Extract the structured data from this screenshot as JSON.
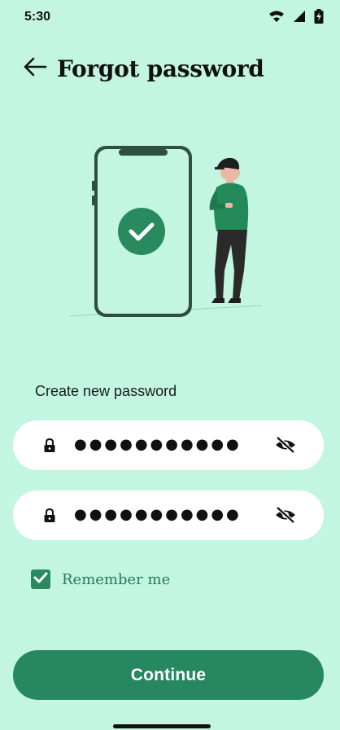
{
  "status_bar": {
    "time": "5:30",
    "icons": [
      "wifi-icon",
      "signal-icon",
      "battery-charging-icon"
    ]
  },
  "header": {
    "title": "Forgot password",
    "back_icon": "arrow-left-icon"
  },
  "form": {
    "section_label": "Create new password",
    "fields": [
      {
        "value": "●●●●●●●●●●●",
        "leading_icon": "lock-icon",
        "trailing_icon": "eye-off-icon"
      },
      {
        "value": "●●●●●●●●●●●",
        "leading_icon": "lock-icon",
        "trailing_icon": "eye-off-icon"
      }
    ],
    "remember": {
      "label": "Remember me",
      "checked": true
    }
  },
  "actions": {
    "continue_label": "Continue"
  },
  "colors": {
    "background": "#c3f6e1",
    "primary": "#268760",
    "field": "#ffffff"
  }
}
